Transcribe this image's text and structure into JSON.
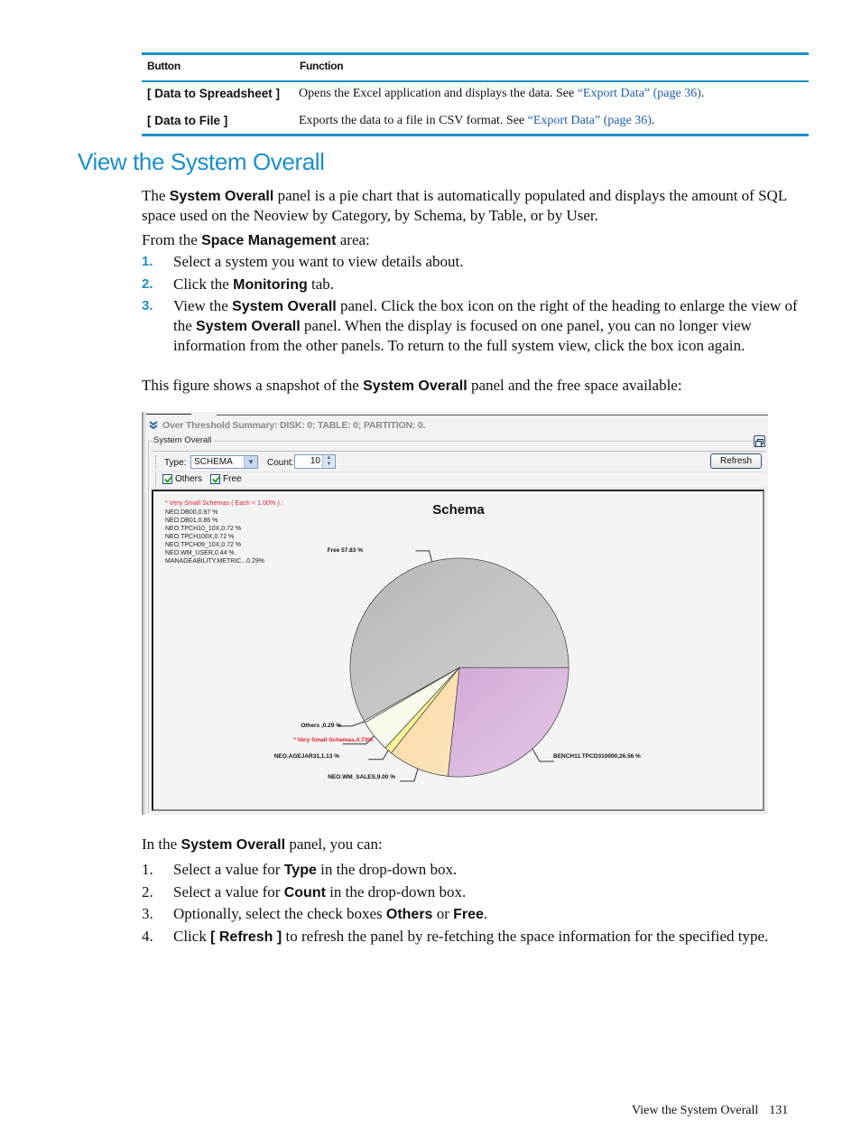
{
  "table": {
    "headers": [
      "Button",
      "Function"
    ],
    "rows": [
      {
        "button": "[ Data to Spreadsheet ]",
        "function_text": "Opens the Excel application and displays the data. See ",
        "link": "“Export Data” (page 36)",
        "tail": "."
      },
      {
        "button": "[ Data to File ]",
        "function_text": "Exports the data to a file in CSV format. See ",
        "link": "“Export Data” (page 36)",
        "tail": "."
      }
    ]
  },
  "section": {
    "title": "View the System Overall",
    "intro": {
      "p1_a": "The ",
      "p1_b": "System Overall",
      "p1_c": " panel is a pie chart that is automatically populated and displays the amount of SQL space used on the Neoview by Category, by Schema, by Table, or by User.",
      "p2_a": "From the ",
      "p2_b": "Space Management",
      "p2_c": " area:"
    },
    "steps": [
      {
        "num": "1.",
        "a": "Select a system you want to view details about.",
        "b": "",
        "c": ""
      },
      {
        "num": "2.",
        "a": "Click the ",
        "b": "Monitoring",
        "c": " tab."
      },
      {
        "num": "3.",
        "a": "View the ",
        "b": "System Overall",
        "c": " panel. Click the box icon on the right of the heading to enlarge the view of the ",
        "d": "System Overall",
        "e": " panel. When the display is focused on one panel, you can no longer view information from the other panels. To return to the full system view, click the box icon again."
      }
    ],
    "figure_caption": {
      "a": "This figure shows a snapshot of the ",
      "b": "System Overall",
      "c": " panel and the free space available:"
    },
    "after": {
      "a": "In the ",
      "b": "System Overall",
      "c": " panel, you can:"
    },
    "actions": [
      {
        "num": "1.",
        "a": "Select a value for ",
        "b": "Type",
        "c": " in the drop-down box."
      },
      {
        "num": "2.",
        "a": "Select a value for ",
        "b": "Count",
        "c": " in the drop-down box."
      },
      {
        "num": "3.",
        "a": "Optionally, select the check boxes ",
        "b": "Others",
        "c": " or ",
        "d": "Free",
        "e": "."
      },
      {
        "num": "4.",
        "a": "Click ",
        "b": "[ Refresh ]",
        "c": " to refresh the panel by re-fetching the space information for the specified type."
      }
    ]
  },
  "panel": {
    "threshold_summary": "Over Threshold Summary: DISK: 0; TABLE: 0; PARTITION: 0.",
    "group_label": "System Overall",
    "type_label": "Type:",
    "type_value": "SCHEMA",
    "count_label": "Count:",
    "count_value": "10",
    "refresh_label": "Refresh",
    "others_label": "Others",
    "others_checked": true,
    "free_label": "Free",
    "free_checked": true
  },
  "chart_data": {
    "type": "pie",
    "title": "Schema",
    "small_legend_title": "* Very Small Schemas ( Each < 1.00% ) :",
    "small_legend_items": [
      "NEO.DB00,0.97 %",
      "NEO.DB01,0.86 %",
      "NEO.TPCH10_10X,0.72 %",
      "NEO.TPCH100X,0.72 %",
      "NEO.TPCH09_10X,0.72 %",
      "NEO.WM_USER,0.44 %",
      "MANAGEABILITY.METRIC...0.29%"
    ],
    "slices": [
      {
        "name": "BENCH11.TPCD310000",
        "value": 26.56,
        "label": "BENCH11.TPCD310000,26.56 %",
        "color": "#d2a6d6",
        "label_color": "#111111"
      },
      {
        "name": "NEO.WM_SALES",
        "value": 9.0,
        "label": "NEO.WM_SALES,9.00 %",
        "color": "#fcd79a",
        "label_color": "#111111"
      },
      {
        "name": "NEO.AGEJAR31",
        "value": 1.13,
        "label": "NEO.AGEJAR31,1.13 %",
        "color": "#f7f27a",
        "label_color": "#111111"
      },
      {
        "name": "* Very Small Schemas",
        "value": 4.73,
        "label": "* Very Small Schemas,4.73%",
        "color": "#f8f8e8",
        "label_color": "#e8202a"
      },
      {
        "name": "Others",
        "value": 0.29,
        "label": "Others ,0.29 %",
        "color": "#e8e8e8",
        "label_color": "#111111"
      },
      {
        "name": "Free",
        "value": 57.83,
        "label": "Free 57.83 %",
        "color": "#b5b5b5",
        "label_color": "#111111"
      }
    ]
  },
  "footer": {
    "title": "View the System Overall",
    "page": "131"
  }
}
